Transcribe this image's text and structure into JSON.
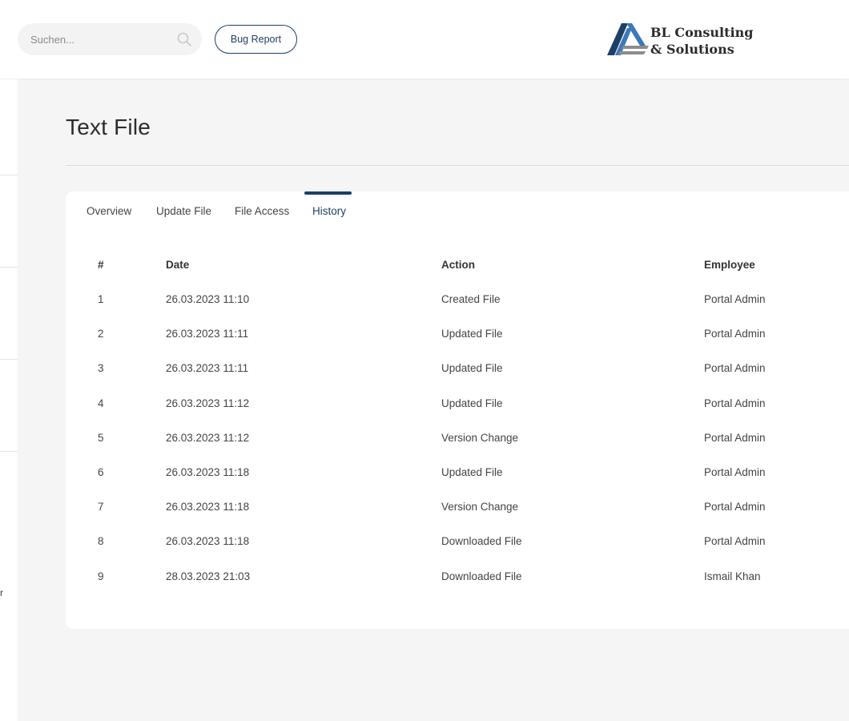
{
  "header": {
    "search_placeholder": "Suchen...",
    "bug_report_label": "Bug Report",
    "logo_line1": "BL Consulting",
    "logo_line2": "& Solutions"
  },
  "sidebar": {
    "glyph": "r"
  },
  "page": {
    "title": "Text File"
  },
  "tabs": [
    {
      "label": "Overview",
      "active": false
    },
    {
      "label": "Update File",
      "active": false
    },
    {
      "label": "File Access",
      "active": false
    },
    {
      "label": "History",
      "active": true
    }
  ],
  "table": {
    "headers": [
      "#",
      "Date",
      "Action",
      "Employee"
    ],
    "rows": [
      [
        "1",
        "26.03.2023 11:10",
        "Created File",
        "Portal Admin"
      ],
      [
        "2",
        "26.03.2023 11:11",
        "Updated File",
        "Portal Admin"
      ],
      [
        "3",
        "26.03.2023 11:11",
        "Updated File",
        "Portal Admin"
      ],
      [
        "4",
        "26.03.2023 11:12",
        "Updated File",
        "Portal Admin"
      ],
      [
        "5",
        "26.03.2023 11:12",
        "Version Change",
        "Portal Admin"
      ],
      [
        "6",
        "26.03.2023 11:18",
        "Updated File",
        "Portal Admin"
      ],
      [
        "7",
        "26.03.2023 11:18",
        "Version Change",
        "Portal Admin"
      ],
      [
        "8",
        "26.03.2023 11:18",
        "Downloaded File",
        "Portal Admin"
      ],
      [
        "9",
        "28.03.2023 21:03",
        "Downloaded File",
        "Ismail Khan"
      ]
    ]
  },
  "colors": {
    "accent": "#1e3f66",
    "logo_blue_dark": "#1e3f66",
    "logo_blue_light": "#3d78b8",
    "logo_gray": "#8c8c8c"
  },
  "icons": {
    "search": "search-icon"
  }
}
